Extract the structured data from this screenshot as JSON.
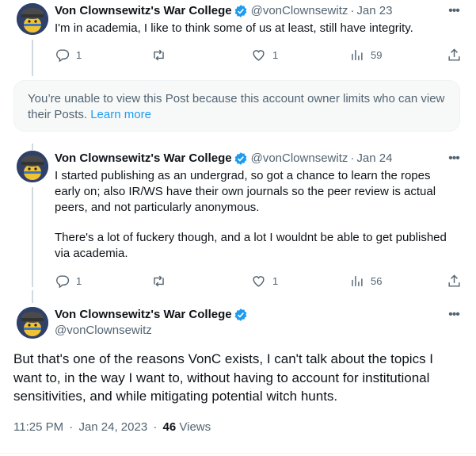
{
  "tweets": [
    {
      "name": "Von Clownsewitz's War College",
      "handle": "@vonClownsewitz",
      "date": "Jan 23",
      "text": "I'm in academia, I like to think some of us at least, still have integrity.",
      "reply_count": "1",
      "like_count": "1",
      "view_count": "59"
    },
    {
      "name": "Von Clownsewitz's War College",
      "handle": "@vonClownsewitz",
      "date": "Jan 24",
      "paragraphs": [
        "I started publishing as an undergrad, so got a chance to learn the ropes early on; also IR/WS have their own journals so the peer review is actual peers, and not particularly anonymous.",
        "There's a lot of fuckery though, and a lot I wouldnt be able to get published via academia."
      ],
      "reply_count": "1",
      "like_count": "1",
      "view_count": "56"
    }
  ],
  "limited_notice": {
    "text": "You’re unable to view this Post because this account owner limits who can view their Posts.",
    "link": "Learn more"
  },
  "main_tweet": {
    "name": "Von Clownsewitz's War College",
    "handle": "@vonClownsewitz",
    "text": "But that's one of the reasons VonC exists, I can't talk about the topics I want to, in the way I want to, without having to account for institutional sensitivities, and while mitigating potential witch hunts.",
    "time": "11:25 PM",
    "date": "Jan 24, 2023",
    "views_count": "46",
    "views_label": "Views"
  },
  "ui": {
    "dot": "·",
    "more": "•••"
  },
  "colors": {
    "accent": "#1d9bf0",
    "text": "#0f1419",
    "secondary": "#536471",
    "notice_bg": "#f7f9f9"
  },
  "icons": [
    "verified-badge-icon",
    "reply-icon",
    "retweet-icon",
    "like-icon",
    "views-icon",
    "share-icon",
    "more-icon"
  ]
}
